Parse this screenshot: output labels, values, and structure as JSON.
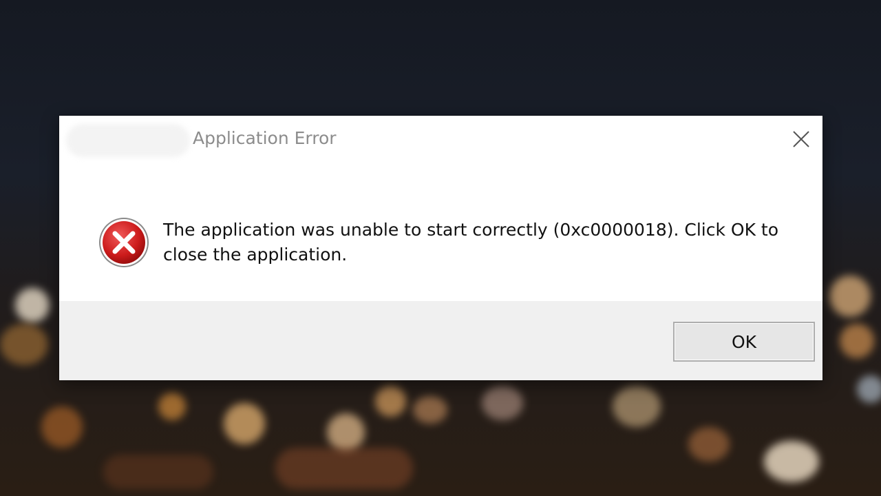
{
  "dialog": {
    "title": "Application Error",
    "message": "The application was unable to start correctly (0xc0000018). Click OK to close the application.",
    "ok_label": "OK"
  },
  "icons": {
    "close": "close-icon",
    "error": "error-icon"
  },
  "colors": {
    "dialog_bg": "#ffffff",
    "footer_bg": "#f0f0f0",
    "error_red": "#d21f1f"
  }
}
